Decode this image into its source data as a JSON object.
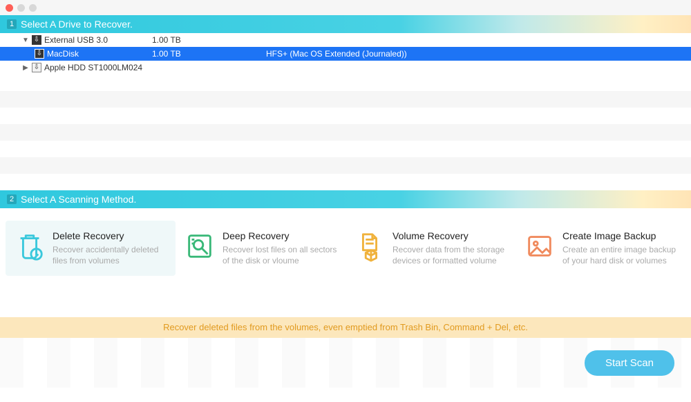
{
  "section1": {
    "step": "1",
    "title": "Select A Drive to Recover."
  },
  "drives": [
    {
      "name": "External USB 3.0",
      "size": "1.00 TB",
      "format": "",
      "level": 1,
      "expanded": true,
      "selected": false,
      "iconStyle": "black"
    },
    {
      "name": "MacDisk",
      "size": "1.00 TB",
      "format": "HFS+ (Mac OS Extended (Journaled))",
      "level": 2,
      "expanded": false,
      "selected": true,
      "iconStyle": "black"
    },
    {
      "name": "Apple HDD ST1000LM024",
      "size": "",
      "format": "",
      "level": 1,
      "expanded": false,
      "selected": false,
      "iconStyle": "light"
    }
  ],
  "section2": {
    "step": "2",
    "title": "Select A Scanning Method."
  },
  "methods": [
    {
      "title": "Delete Recovery",
      "desc": "Recover accidentally deleted files from volumes",
      "color": "#3ac8dc",
      "selected": true
    },
    {
      "title": "Deep Recovery",
      "desc": "Recover lost files on all sectors of the disk or vloume",
      "color": "#39b878",
      "selected": false
    },
    {
      "title": "Volume Recovery",
      "desc": "Recover data from the storage devices or formatted volume",
      "color": "#f0b23c",
      "selected": false
    },
    {
      "title": "Create Image Backup",
      "desc": "Create an entire image backup of your hard disk or volumes",
      "color": "#f08a5d",
      "selected": false
    }
  ],
  "tip": "Recover deleted files from the volumes, even emptied from Trash Bin, Command + Del, etc.",
  "scan_label": "Start Scan"
}
